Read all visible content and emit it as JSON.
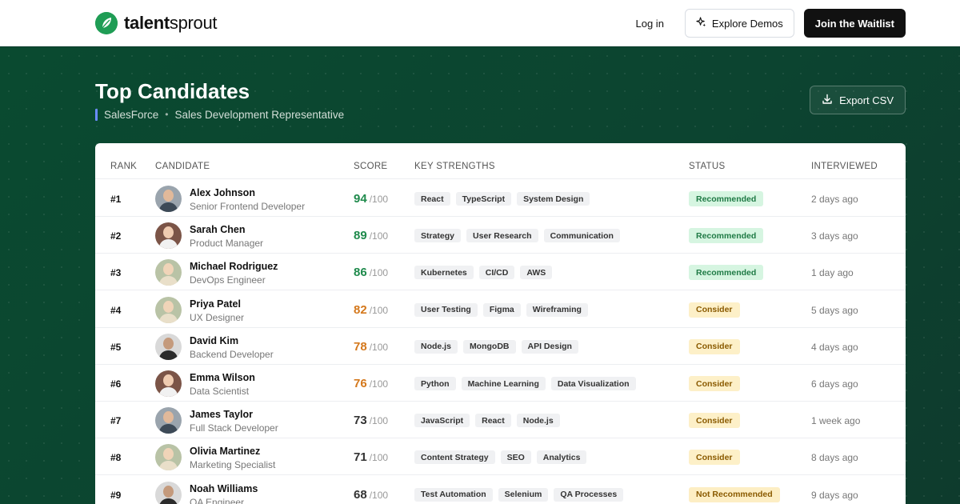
{
  "brand": {
    "name_bold": "talent",
    "name_rest": "sprout",
    "accent": "#1f9d55"
  },
  "nav": {
    "login": "Log in",
    "explore": "Explore Demos",
    "waitlist": "Join the Waitlist"
  },
  "page": {
    "title": "Top Candidates",
    "company": "SalesForce",
    "separator": "•",
    "position": "Sales Development Representative",
    "export": "Export CSV"
  },
  "table": {
    "headers": {
      "rank": "RANK",
      "candidate": "CANDIDATE",
      "score": "SCORE",
      "strengths": "KEY STRENGTHS",
      "status": "STATUS",
      "interviewed": "INTERVIEWED"
    },
    "score_suffix": "/100",
    "rows": [
      {
        "rank": "#1",
        "name": "Alex Johnson",
        "role": "Senior Frontend Developer",
        "score": "94",
        "score_color": "#1f8a4c",
        "strengths": [
          "React",
          "TypeScript",
          "System Design"
        ],
        "status": "Recommended",
        "status_kind": "recommended",
        "interviewed": "2 days ago",
        "avatar": "male-1"
      },
      {
        "rank": "#2",
        "name": "Sarah Chen",
        "role": "Product Manager",
        "score": "89",
        "score_color": "#1f8a4c",
        "strengths": [
          "Strategy",
          "User Research",
          "Communication"
        ],
        "status": "Recommended",
        "status_kind": "recommended",
        "interviewed": "3 days ago",
        "avatar": "female-1"
      },
      {
        "rank": "#3",
        "name": "Michael Rodriguez",
        "role": "DevOps Engineer",
        "score": "86",
        "score_color": "#1f8a4c",
        "strengths": [
          "Kubernetes",
          "CI/CD",
          "AWS"
        ],
        "status": "Recommended",
        "status_kind": "recommended",
        "interviewed": "1 day ago",
        "avatar": "female-2"
      },
      {
        "rank": "#4",
        "name": "Priya Patel",
        "role": "UX Designer",
        "score": "82",
        "score_color": "#d4781c",
        "strengths": [
          "User Testing",
          "Figma",
          "Wireframing"
        ],
        "status": "Consider",
        "status_kind": "consider",
        "interviewed": "5 days ago",
        "avatar": "female-2"
      },
      {
        "rank": "#5",
        "name": "David Kim",
        "role": "Backend Developer",
        "score": "78",
        "score_color": "#d4781c",
        "strengths": [
          "Node.js",
          "MongoDB",
          "API Design"
        ],
        "status": "Consider",
        "status_kind": "consider",
        "interviewed": "4 days ago",
        "avatar": "male-2"
      },
      {
        "rank": "#6",
        "name": "Emma Wilson",
        "role": "Data Scientist",
        "score": "76",
        "score_color": "#d4781c",
        "strengths": [
          "Python",
          "Machine Learning",
          "Data Visualization"
        ],
        "status": "Consider",
        "status_kind": "consider",
        "interviewed": "6 days ago",
        "avatar": "female-1"
      },
      {
        "rank": "#7",
        "name": "James Taylor",
        "role": "Full Stack Developer",
        "score": "73",
        "score_color": "#333333",
        "strengths": [
          "JavaScript",
          "React",
          "Node.js"
        ],
        "status": "Consider",
        "status_kind": "consider",
        "interviewed": "1 week ago",
        "avatar": "male-1"
      },
      {
        "rank": "#8",
        "name": "Olivia Martinez",
        "role": "Marketing Specialist",
        "score": "71",
        "score_color": "#333333",
        "strengths": [
          "Content Strategy",
          "SEO",
          "Analytics"
        ],
        "status": "Consider",
        "status_kind": "consider",
        "interviewed": "8 days ago",
        "avatar": "female-2"
      },
      {
        "rank": "#9",
        "name": "Noah Williams",
        "role": "QA Engineer",
        "score": "68",
        "score_color": "#333333",
        "strengths": [
          "Test Automation",
          "Selenium",
          "QA Processes"
        ],
        "status": "Not Recommended",
        "status_kind": "not-recommended",
        "interviewed": "9 days ago",
        "avatar": "male-2"
      }
    ]
  },
  "status_colors": {
    "recommended": {
      "bg": "#d6f5e1",
      "fg": "#1f7a45"
    },
    "consider": {
      "bg": "#fdf0c8",
      "fg": "#8a5a00"
    },
    "not-recommended": {
      "bg": "#fdeec4",
      "fg": "#8a5a00"
    }
  }
}
